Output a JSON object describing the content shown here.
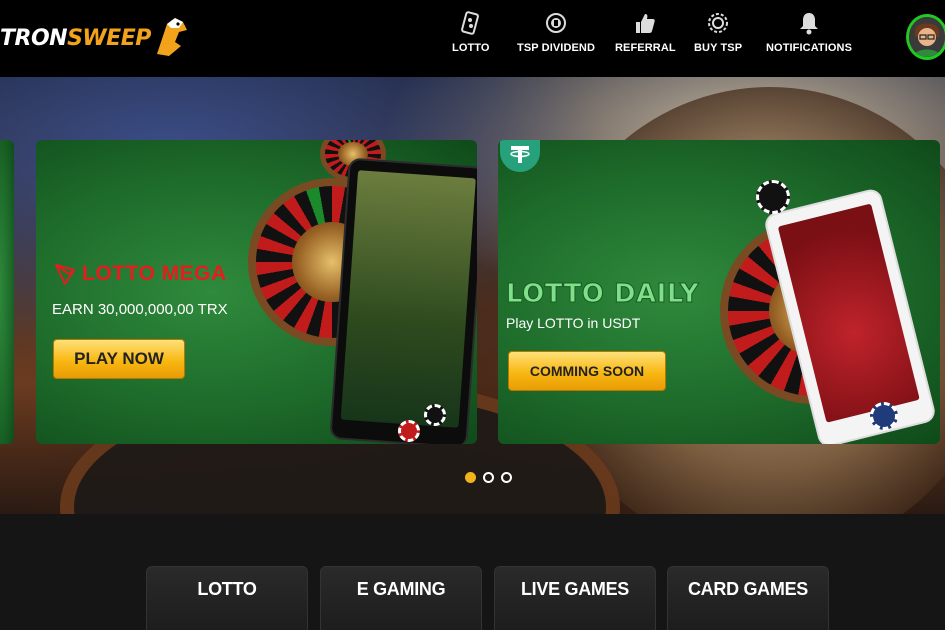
{
  "header": {
    "logo": {
      "text_a": "TRON",
      "text_b": "SWEEP"
    },
    "nav": [
      {
        "label": "LOTTO",
        "icon": "lotto-ticket-icon"
      },
      {
        "label": "TSP DIVIDEND",
        "icon": "dividend-coin-icon"
      },
      {
        "label": "REFERRAL",
        "icon": "thumbs-up-icon"
      },
      {
        "label": "BUY TSP",
        "icon": "token-icon"
      },
      {
        "label": "NOTIFICATIONS",
        "icon": "bell-icon"
      }
    ],
    "avatar": {
      "icon": "user-avatar-icon",
      "ring_color": "#21c921"
    }
  },
  "hero": {
    "slides": [
      {
        "title": "LOTTO MEGA",
        "subtitle": "EARN 30,000,000,00 TRX",
        "button": "PLAY NOW",
        "icon": "tron-logo-icon",
        "title_color": "#e51d1d"
      },
      {
        "title": "LOTTO DAILY",
        "subtitle": "Play LOTTO in USDT",
        "button": "COMMING SOON",
        "icon": "tether-icon",
        "title_color": "#7fe08a"
      }
    ],
    "carousel": {
      "count": 3,
      "active_index": 0
    }
  },
  "categories": [
    {
      "label": "LOTTO"
    },
    {
      "label": "E GAMING"
    },
    {
      "label": "LIVE GAMES"
    },
    {
      "label": "CARD GAMES"
    }
  ],
  "colors": {
    "accent": "#f8b812",
    "header_bg": "#000000",
    "page_bg": "#151515"
  }
}
